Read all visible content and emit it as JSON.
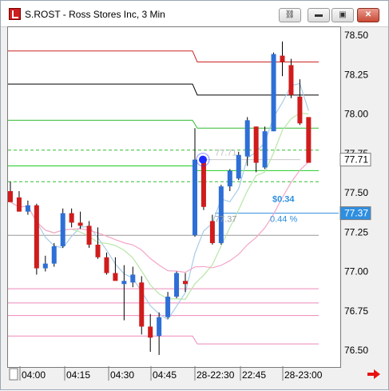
{
  "window": {
    "title": "S.ROST - Ross Stores Inc, 3 Min",
    "buttons": [
      {
        "name": "link-icon",
        "glyph": "⛓"
      },
      {
        "name": "minimize-button",
        "glyph": "▬"
      },
      {
        "name": "restore-button",
        "glyph": "▣"
      },
      {
        "name": "close-button",
        "glyph": "✕"
      }
    ]
  },
  "chart_data": {
    "type": "candlestick",
    "symbol": "S.ROST",
    "interval": "3 Min",
    "y_ticks": [
      "78.50",
      "78.25",
      "78.00",
      "77.75",
      "77.50",
      "77.25",
      "77.00",
      "76.75",
      "76.50"
    ],
    "x_ticks": [
      "04:00",
      "04:15",
      "04:30",
      "04:45",
      "28-22:30",
      "22:45",
      "28-23:00"
    ],
    "price_tags": [
      {
        "label": "77.71",
        "value": 77.71,
        "color": "#ffffff",
        "text_color": "#000000"
      },
      {
        "label": "77.37",
        "value": 77.37,
        "color": "#2e8fe0",
        "text_color": "#ffffff"
      }
    ],
    "annotations": [
      {
        "text": "$0.34",
        "color": "#2e8fe0"
      },
      {
        "text": "0.44 %",
        "color": "#2e8fe0"
      },
      {
        "text": "77.71",
        "color": "#c0c0c0"
      },
      {
        "text": "77.37",
        "color": "#9aa0a6"
      }
    ],
    "candles": [
      {
        "o": 77.51,
        "h": 77.57,
        "l": 77.45,
        "c": 77.44,
        "up": false
      },
      {
        "o": 77.47,
        "h": 77.51,
        "l": 77.38,
        "c": 77.38,
        "up": false
      },
      {
        "o": 77.38,
        "h": 77.45,
        "l": 77.36,
        "c": 77.42,
        "up": true
      },
      {
        "o": 77.42,
        "h": 77.43,
        "l": 76.98,
        "c": 77.02,
        "up": false
      },
      {
        "o": 77.02,
        "h": 77.1,
        "l": 77.0,
        "c": 77.05,
        "up": true
      },
      {
        "o": 77.05,
        "h": 77.18,
        "l": 77.03,
        "c": 77.16,
        "up": true
      },
      {
        "o": 77.16,
        "h": 77.4,
        "l": 77.15,
        "c": 77.37,
        "up": true
      },
      {
        "o": 77.37,
        "h": 77.4,
        "l": 77.28,
        "c": 77.31,
        "up": false
      },
      {
        "o": 77.31,
        "h": 77.38,
        "l": 77.27,
        "c": 77.29,
        "up": false
      },
      {
        "o": 77.29,
        "h": 77.32,
        "l": 77.15,
        "c": 77.17,
        "up": false
      },
      {
        "o": 77.17,
        "h": 77.28,
        "l": 77.08,
        "c": 77.09,
        "up": false
      },
      {
        "o": 77.09,
        "h": 77.12,
        "l": 76.98,
        "c": 76.99,
        "up": false
      },
      {
        "o": 76.99,
        "h": 77.09,
        "l": 76.95,
        "c": 76.94,
        "up": false
      },
      {
        "o": 76.94,
        "h": 77.04,
        "l": 76.69,
        "c": 76.92,
        "up": true
      },
      {
        "o": 76.93,
        "h": 77.03,
        "l": 76.9,
        "c": 76.98,
        "up": true
      },
      {
        "o": 76.93,
        "h": 76.97,
        "l": 76.6,
        "c": 76.65,
        "up": false
      },
      {
        "o": 76.65,
        "h": 76.73,
        "l": 76.49,
        "c": 76.58,
        "up": false
      },
      {
        "o": 76.59,
        "h": 76.74,
        "l": 76.47,
        "c": 76.71,
        "up": true
      },
      {
        "o": 76.71,
        "h": 76.87,
        "l": 76.7,
        "c": 76.84,
        "up": true
      },
      {
        "o": 76.84,
        "h": 77.0,
        "l": 76.83,
        "c": 76.99,
        "up": true
      },
      {
        "o": 76.94,
        "h": 76.99,
        "l": 76.87,
        "c": 76.92,
        "up": false
      },
      {
        "o": 77.23,
        "h": 77.91,
        "l": 77.22,
        "c": 77.71,
        "up": true
      },
      {
        "o": 77.71,
        "h": 77.72,
        "l": 77.39,
        "c": 77.41,
        "up": false
      },
      {
        "o": 77.32,
        "h": 77.36,
        "l": 77.17,
        "c": 77.18,
        "up": false
      },
      {
        "o": 77.18,
        "h": 77.55,
        "l": 77.17,
        "c": 77.54,
        "up": true
      },
      {
        "o": 77.54,
        "h": 77.65,
        "l": 77.51,
        "c": 77.64,
        "up": true
      },
      {
        "o": 77.59,
        "h": 77.76,
        "l": 77.58,
        "c": 77.74,
        "up": true
      },
      {
        "o": 77.73,
        "h": 77.98,
        "l": 77.67,
        "c": 77.96,
        "up": true
      },
      {
        "o": 77.92,
        "h": 77.92,
        "l": 77.63,
        "c": 77.69,
        "up": false
      },
      {
        "o": 77.66,
        "h": 77.92,
        "l": 77.65,
        "c": 77.89,
        "up": true
      },
      {
        "o": 77.89,
        "h": 78.39,
        "l": 77.89,
        "c": 78.38,
        "up": true
      },
      {
        "o": 78.37,
        "h": 78.46,
        "l": 78.24,
        "c": 78.33,
        "up": false
      },
      {
        "o": 78.31,
        "h": 78.35,
        "l": 78.1,
        "c": 78.12,
        "up": false
      },
      {
        "o": 78.11,
        "h": 78.22,
        "l": 77.93,
        "c": 77.94,
        "up": false
      },
      {
        "o": 77.98,
        "h": 77.98,
        "l": 77.7,
        "c": 77.69,
        "up": false
      }
    ],
    "level_lines": [
      {
        "name": "red-resistance-line",
        "color": "#cc2222",
        "seg1": 78.4,
        "seg2": 78.33
      },
      {
        "name": "black-resistance-line",
        "color": "#000000",
        "seg1": 78.19,
        "seg2": 78.12
      },
      {
        "name": "green-upper-line",
        "color": "#33bb33",
        "seg1": 77.96,
        "seg2": 77.91
      },
      {
        "name": "green-mid-line",
        "color": "#22cc22",
        "seg1": 77.67,
        "seg2": 77.64
      },
      {
        "name": "pink-low-line-1",
        "color": "#ee88bb",
        "seg1": 76.89,
        "seg2": 76.89
      },
      {
        "name": "pink-low-line-2",
        "color": "#ee88bb",
        "seg1": 76.8,
        "seg2": 76.8
      },
      {
        "name": "pink-low-line-3",
        "color": "#ee88bb",
        "seg1": 76.72,
        "seg2": 76.72
      },
      {
        "name": "pink-low-line-4",
        "color": "#ee88bb",
        "seg1": 76.59,
        "seg2": 76.54
      }
    ],
    "colors": {
      "up": "#2e6fd6",
      "down": "#d01c1c",
      "ma_fast": "#a8cce8",
      "ma_mid": "#b8e6a8",
      "ma_slow": "#f4a6c8",
      "marker": "#1a2cff"
    }
  },
  "nav": {
    "forward_arrow": "scroll-right-arrow"
  }
}
